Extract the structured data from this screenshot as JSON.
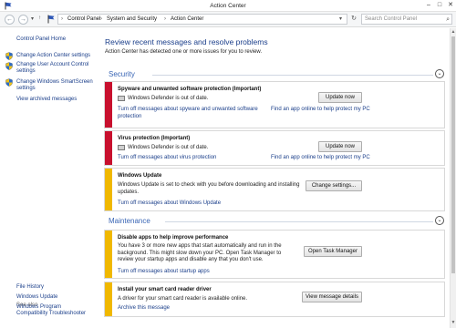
{
  "window": {
    "title": "Action Center",
    "icon": "flag-icon"
  },
  "toolbar": {
    "breadcrumb": [
      "Control Panel",
      "System and Security",
      "Action Center"
    ],
    "search_placeholder": "Search Control Panel",
    "back_icon": "←",
    "forward_icon": "→",
    "up_icon": "↑",
    "refresh_icon": "↻",
    "separator": "›",
    "dropdown_icon": "▾"
  },
  "sidebar": {
    "home": "Control Panel Home",
    "links": [
      "Change Action Center settings",
      "Change User Account Control settings",
      "Change Windows SmartScreen settings",
      "View archived messages"
    ],
    "see_also_label": "See also",
    "see_also": [
      "File History",
      "Windows Update",
      "Windows Program Compatibility Troubleshooter"
    ]
  },
  "main": {
    "heading": "Review recent messages and resolve problems",
    "subheading": "Action Center has detected one or more issues for you to review.",
    "security": {
      "label": "Security",
      "cards": [
        {
          "title": "Spyware and unwanted software protection (Important)",
          "status": "Windows Defender is out of date.",
          "button": "Update now",
          "link_left": "Turn off messages about spyware and unwanted software protection",
          "link_right": "Find an app online to help protect my PC"
        },
        {
          "title": "Virus protection (Important)",
          "status": "Windows Defender is out of date.",
          "button": "Update now",
          "link_left": "Turn off messages about virus protection",
          "link_right": "Find an app online to help protect my PC"
        },
        {
          "title": "Windows Update",
          "text": "Windows Update is set to check with you before downloading and installing updates.",
          "button": "Change settings...",
          "link_left": "Turn off messages about Windows Update"
        }
      ]
    },
    "maintenance": {
      "label": "Maintenance",
      "cards": [
        {
          "title": "Disable apps to help improve performance",
          "text": "You have 3 or more new apps that start automatically and run in the background. This might slow down your PC. Open Task Manager to review your startup apps and disable any that you don't use.",
          "button": "Open Task Manager",
          "link_left": "Turn off messages about startup apps"
        },
        {
          "title": "Install your smart card reader driver",
          "text": "A driver for your smart card reader is available online.",
          "button": "View message details",
          "link_left": "Archive this message"
        }
      ]
    }
  },
  "colors": {
    "important_red": "#c8102e",
    "warning_yellow": "#f0b800",
    "link_blue": "#1a3e8a",
    "section_blue": "#3a66b5"
  }
}
